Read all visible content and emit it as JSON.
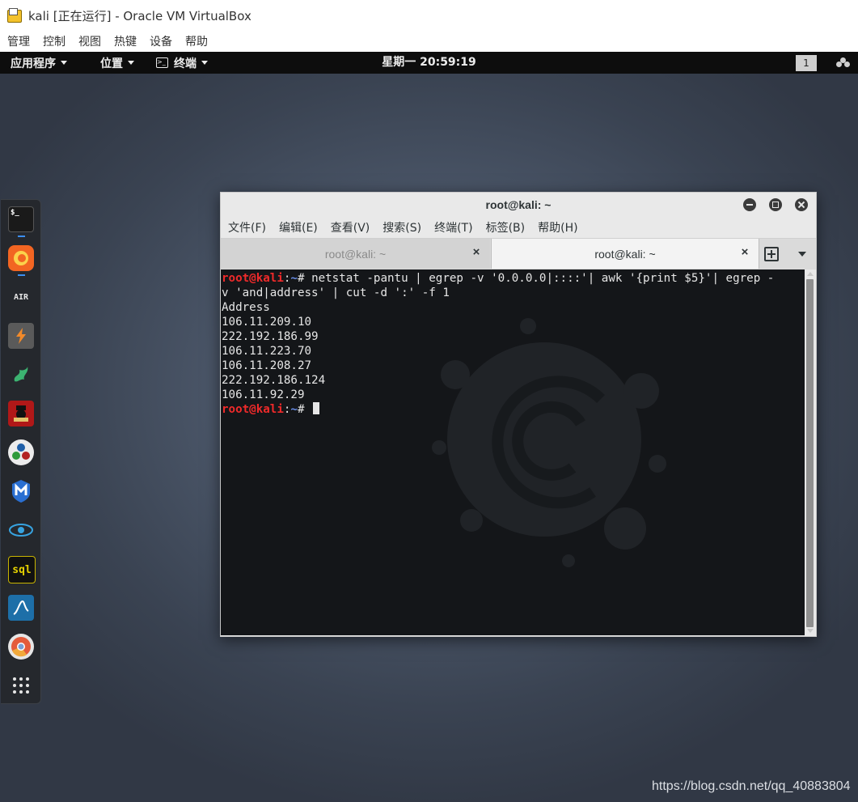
{
  "host_window": {
    "title": "kali [正在运行] - Oracle VM VirtualBox",
    "menu": [
      "管理",
      "控制",
      "视图",
      "热键",
      "设备",
      "帮助"
    ]
  },
  "gnome_panel": {
    "applications": "应用程序",
    "places": "位置",
    "terminal": "终端",
    "clock": "星期一 20:59:19",
    "workspace": "1"
  },
  "dock": {
    "items": [
      {
        "name": "terminal",
        "icon": "terminal-icon",
        "label": "$_"
      },
      {
        "name": "firefox",
        "icon": "firefox-icon"
      },
      {
        "name": "aircrack",
        "icon": "aircrack-icon",
        "label": "AIR"
      },
      {
        "name": "burpsuite",
        "icon": "burpsuite-icon"
      },
      {
        "name": "armitage",
        "icon": "armitage-icon"
      },
      {
        "name": "beef",
        "icon": "beef-icon"
      },
      {
        "name": "maltego",
        "icon": "maltego-icon"
      },
      {
        "name": "metasploit",
        "icon": "metasploit-icon"
      },
      {
        "name": "faraday",
        "icon": "faraday-icon"
      },
      {
        "name": "sqlmap",
        "icon": "sqlmap-icon"
      },
      {
        "name": "wireshark",
        "icon": "wireshark-icon"
      },
      {
        "name": "chromium",
        "icon": "chromium-icon"
      },
      {
        "name": "show-applications",
        "icon": "app-grid-icon"
      }
    ]
  },
  "terminal": {
    "title": "root@kali: ~",
    "menu": [
      "文件(F)",
      "编辑(E)",
      "查看(V)",
      "搜索(S)",
      "终端(T)",
      "标签(B)",
      "帮助(H)"
    ],
    "tabs": [
      {
        "label": "root@kali: ~",
        "active": false
      },
      {
        "label": "root@kali: ~",
        "active": true
      }
    ],
    "prompt_user": "root@kali",
    "prompt_sep": ":",
    "prompt_path": "~",
    "prompt_symbol": "# ",
    "command_line1": "netstat -pantu | egrep -v '0.0.0.0|::::'| awk '{print $5}'| egrep -",
    "command_line2": "v 'and|address' | cut -d ':' -f 1",
    "output": [
      "Address",
      "106.11.209.10",
      "222.192.186.99",
      "106.11.223.70",
      "106.11.208.27",
      "222.192.186.124",
      "106.11.92.29"
    ]
  },
  "watermark": "https://blog.csdn.net/qq_40883804",
  "colors": {
    "prompt_user": "#ef2a2a",
    "prompt_path": "#6a8ee8",
    "terminal_bg": "#141619",
    "dock_indicator": "#3b8ef0"
  }
}
